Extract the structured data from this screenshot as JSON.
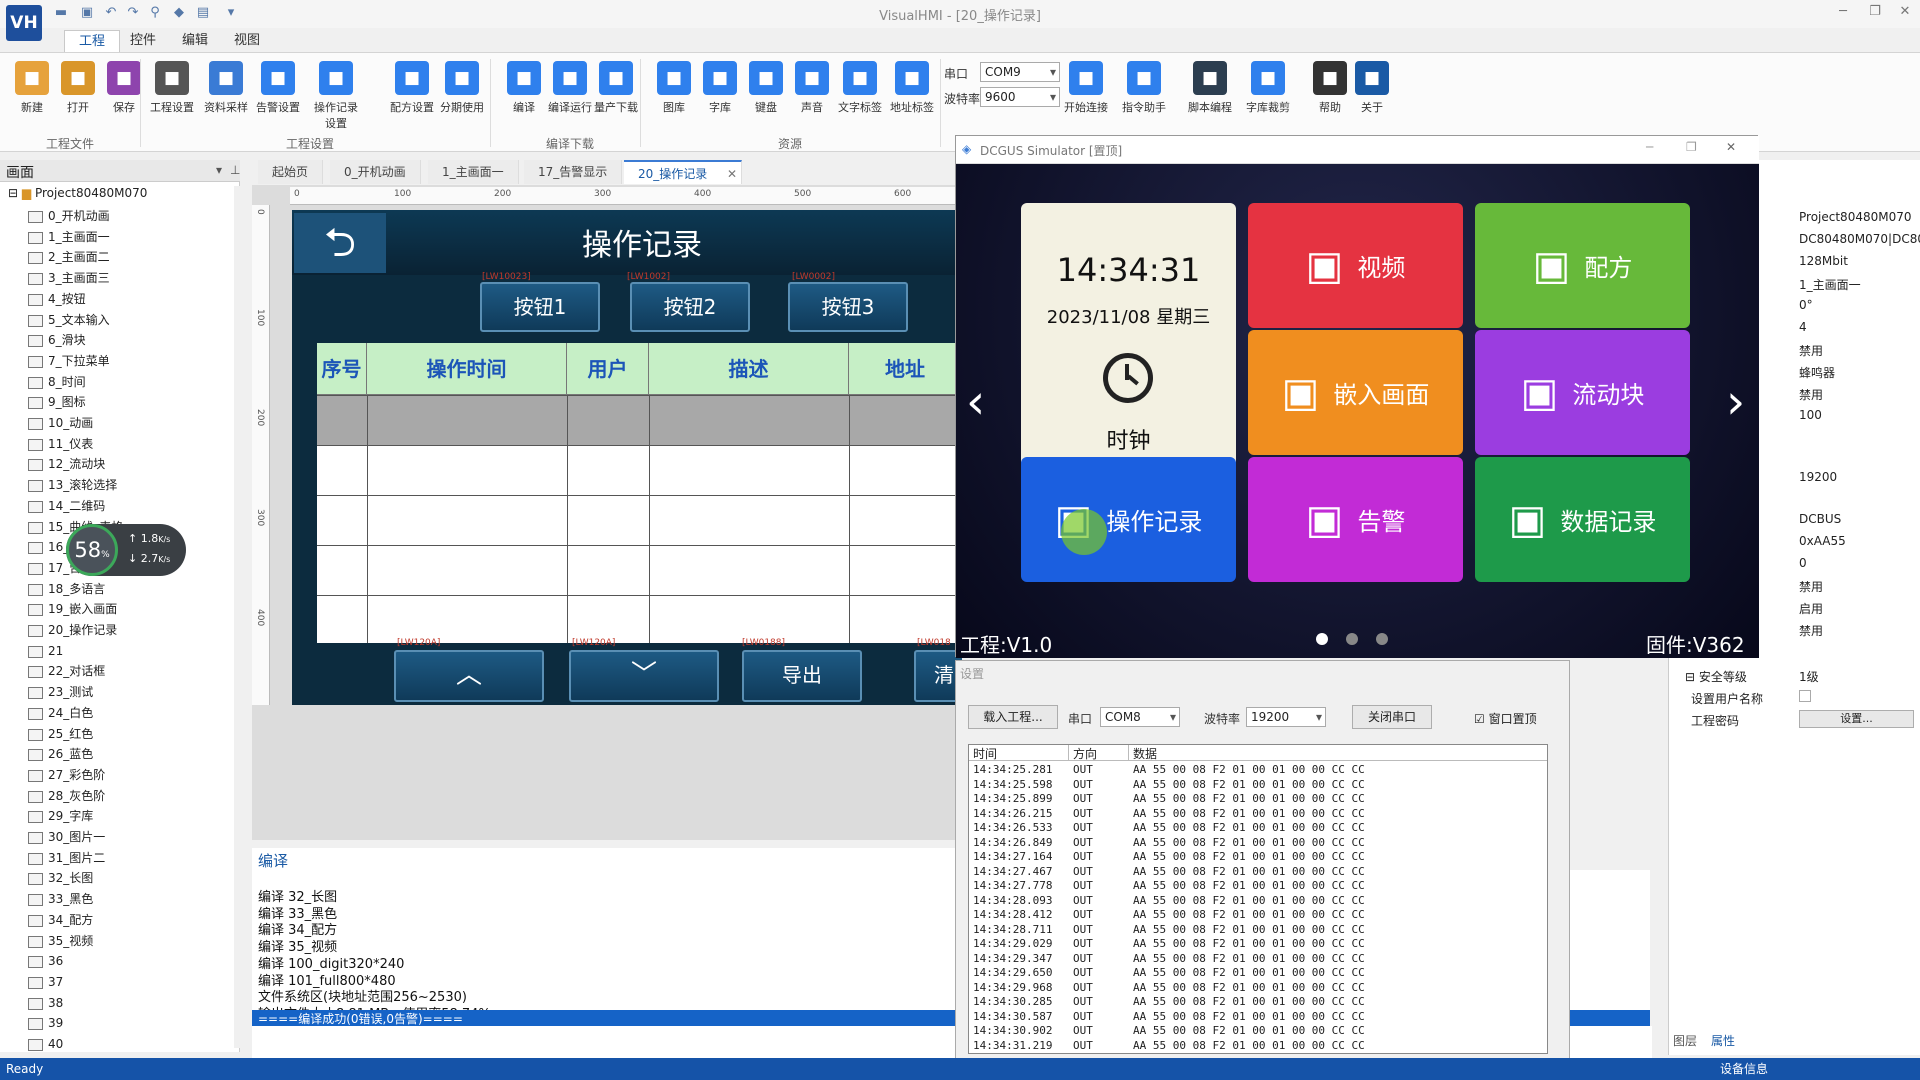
{
  "app": {
    "title": "VisualHMI - [20_操作记录]",
    "logo": "VH",
    "status": "Ready",
    "status_right": "设备信息"
  },
  "menu_tabs": [
    "工程",
    "控件",
    "编辑",
    "视图"
  ],
  "ribbon": {
    "buttons": [
      {
        "label": "新建",
        "icon": "new-file-icon",
        "color": "#e6a23c"
      },
      {
        "label": "打开",
        "icon": "open-folder-icon",
        "color": "#d9962a"
      },
      {
        "label": "保存",
        "icon": "save-icon",
        "color": "#8e44ad"
      },
      {
        "label": "工程设置",
        "icon": "gear-icon",
        "color": "#555"
      },
      {
        "label": "资料采样",
        "icon": "sample-icon",
        "color": "#3a7bd5"
      },
      {
        "label": "告警设置",
        "icon": "alarm-set-icon",
        "color": "#2f80ed"
      },
      {
        "label": "操作记录设置",
        "icon": "op-record-icon",
        "color": "#2f80ed"
      },
      {
        "label": "配方设置",
        "icon": "recipe-icon",
        "color": "#2f80ed"
      },
      {
        "label": "分期使用",
        "icon": "calendar-icon",
        "color": "#2f80ed"
      },
      {
        "label": "编译",
        "icon": "compile-icon",
        "color": "#2f80ed"
      },
      {
        "label": "编译运行",
        "icon": "compile-run-icon",
        "color": "#2f80ed"
      },
      {
        "label": "量产下载",
        "icon": "download-icon",
        "color": "#2f80ed"
      },
      {
        "label": "图库",
        "icon": "image-lib-icon",
        "color": "#2f80ed"
      },
      {
        "label": "字库",
        "icon": "font-lib-icon",
        "color": "#2f80ed"
      },
      {
        "label": "键盘",
        "icon": "keyboard-icon",
        "color": "#2f80ed"
      },
      {
        "label": "声音",
        "icon": "sound-icon",
        "color": "#2f80ed"
      },
      {
        "label": "文字标签",
        "icon": "tag-icon",
        "color": "#2f80ed"
      },
      {
        "label": "地址标签",
        "icon": "addr-tag-icon",
        "color": "#2f80ed"
      },
      {
        "label": "开始连接",
        "icon": "connect-icon",
        "color": "#2f80ed"
      },
      {
        "label": "指令助手",
        "icon": "cmd-helper-icon",
        "color": "#2f80ed"
      },
      {
        "label": "脚本编程",
        "icon": "lua-icon",
        "color": "#2c3e50"
      },
      {
        "label": "字库裁剪",
        "icon": "font-crop-icon",
        "color": "#2f80ed"
      },
      {
        "label": "帮助",
        "icon": "help-icon",
        "color": "#333"
      },
      {
        "label": "关于",
        "icon": "info-icon",
        "color": "#1a5aa5"
      }
    ],
    "groups": [
      "工程文件",
      "工程设置",
      "编译下载",
      "资源"
    ],
    "port_label": "串口",
    "port_value": "COM9",
    "baud_label": "波特率",
    "baud_value": "9600"
  },
  "left_panel": {
    "title": "画面",
    "project": "Project80480M070",
    "items": [
      "0_开机动画",
      "1_主画面一",
      "2_主画面二",
      "3_主画面三",
      "4_按钮",
      "5_文本输入",
      "6_滑块",
      "7_下拉菜单",
      "8_时间",
      "9_图标",
      "10_动画",
      "11_仪表",
      "12_流动块",
      "13_滚轮选择",
      "14_二维码",
      "15_曲线_表格",
      "16_",
      "17_告警显示",
      "18_多语言",
      "19_嵌入画面",
      "20_操作记录",
      "21",
      "22_对话框",
      "23_测试",
      "24_白色",
      "25_红色",
      "26_蓝色",
      "27_彩色阶",
      "28_灰色阶",
      "29_字库",
      "30_图片一",
      "31_图片二",
      "32_长图",
      "33_黑色",
      "34_配方",
      "35_视频",
      "36",
      "37",
      "38",
      "39",
      "40"
    ]
  },
  "perf": {
    "cpu": "58",
    "unit": "%",
    "up": "1.8",
    "down": "2.7",
    "rate_unit": "K/s"
  },
  "doc_tabs": [
    "起始页",
    "0_开机动画",
    "1_主画面一",
    "17_告警显示",
    "20_操作记录"
  ],
  "ruler_h": [
    "0",
    "100",
    "200",
    "300",
    "400",
    "500",
    "600"
  ],
  "ruler_v": [
    "0",
    "100",
    "200",
    "300",
    "400"
  ],
  "hmi": {
    "title": "操作记录",
    "back": "⮌",
    "buttons": [
      "按钮1",
      "按钮2",
      "按钮3"
    ],
    "tags_top": [
      "[LW10023]",
      "[LW1002]",
      "[LW0002]"
    ],
    "tags_bottom": [
      "[LW120A]",
      "[LW120A]",
      "[LW0188]",
      "[LW018"
    ],
    "columns": [
      "序号",
      "操作时间",
      "用户",
      "描述",
      "地址"
    ],
    "nav_buttons": [
      "︿",
      "﹀",
      "导出",
      "清"
    ]
  },
  "compile": {
    "title": "编译",
    "lines": [
      "编译 32_长图",
      "编译 33_黑色",
      "编译 34_配方",
      "编译 35_视频",
      "编译 100_digit320*240",
      "编译 101_full800*480",
      "文件系统区(块地址范围256~2530)",
      "输出文件大小8.81 MB，使用率58.74%."
    ],
    "highlight": "====编译成功(0错误,0告警)===="
  },
  "props": {
    "values": [
      "Project80480M070",
      "DC80480M070|DC80",
      "128Mbit",
      "1_主画面一",
      "0°",
      "4",
      "禁用",
      "蜂鸣器",
      "禁用",
      "100",
      "",
      "19200",
      "DCBUS",
      "0xAA55",
      "0",
      "禁用",
      "启用",
      "禁用"
    ],
    "security_label": "安全等级",
    "security_value": "1级",
    "user_label": "设置用户名称",
    "pwd_label": "工程密码",
    "pwd_btn": "设置...",
    "tab1": "图层",
    "tab2": "属性"
  },
  "simulator": {
    "title": "DCGUS Simulator [置顶]",
    "time": "14:34:31",
    "date": "2023/11/08 星期三",
    "clock_label": "时钟",
    "tiles": [
      {
        "label": "视频",
        "icon": "video-icon",
        "color": "#e53341"
      },
      {
        "label": "配方",
        "icon": "recipe-icon",
        "color": "#67b93a"
      },
      {
        "label": "嵌入画面",
        "icon": "embed-icon",
        "color": "#f08e1f"
      },
      {
        "label": "流动块",
        "icon": "flow-icon",
        "color": "#9b3de0"
      },
      {
        "label": "操作记录",
        "icon": "op-record-icon",
        "color": "#1b5fe0"
      },
      {
        "label": "告警",
        "icon": "warning-icon",
        "color": "#c22bd6"
      },
      {
        "label": "数据记录",
        "icon": "data-record-icon",
        "color": "#1e9a4a"
      }
    ],
    "project_ver": "工程:V1.0",
    "firmware_ver": "固件:V362"
  },
  "settings": {
    "title": "设置",
    "load_btn": "载入工程...",
    "port_label": "串口",
    "port": "COM8",
    "baud_label": "波特率",
    "baud": "19200",
    "close_btn": "关闭串口",
    "topmost": "窗口置顶",
    "headers": [
      "时间",
      "方向",
      "数据"
    ],
    "rows": [
      [
        "14:34:25.281",
        "OUT",
        "AA 55 00 08 F2 01 00 01 00 00 CC CC"
      ],
      [
        "14:34:25.598",
        "OUT",
        "AA 55 00 08 F2 01 00 01 00 00 CC CC"
      ],
      [
        "14:34:25.899",
        "OUT",
        "AA 55 00 08 F2 01 00 01 00 00 CC CC"
      ],
      [
        "14:34:26.215",
        "OUT",
        "AA 55 00 08 F2 01 00 01 00 00 CC CC"
      ],
      [
        "14:34:26.533",
        "OUT",
        "AA 55 00 08 F2 01 00 01 00 00 CC CC"
      ],
      [
        "14:34:26.849",
        "OUT",
        "AA 55 00 08 F2 01 00 01 00 00 CC CC"
      ],
      [
        "14:34:27.164",
        "OUT",
        "AA 55 00 08 F2 01 00 01 00 00 CC CC"
      ],
      [
        "14:34:27.467",
        "OUT",
        "AA 55 00 08 F2 01 00 01 00 00 CC CC"
      ],
      [
        "14:34:27.778",
        "OUT",
        "AA 55 00 08 F2 01 00 01 00 00 CC CC"
      ],
      [
        "14:34:28.093",
        "OUT",
        "AA 55 00 08 F2 01 00 01 00 00 CC CC"
      ],
      [
        "14:34:28.412",
        "OUT",
        "AA 55 00 08 F2 01 00 01 00 00 CC CC"
      ],
      [
        "14:34:28.711",
        "OUT",
        "AA 55 00 08 F2 01 00 01 00 00 CC CC"
      ],
      [
        "14:34:29.029",
        "OUT",
        "AA 55 00 08 F2 01 00 01 00 00 CC CC"
      ],
      [
        "14:34:29.347",
        "OUT",
        "AA 55 00 08 F2 01 00 01 00 00 CC CC"
      ],
      [
        "14:34:29.650",
        "OUT",
        "AA 55 00 08 F2 01 00 01 00 00 CC CC"
      ],
      [
        "14:34:29.968",
        "OUT",
        "AA 55 00 08 F2 01 00 01 00 00 CC CC"
      ],
      [
        "14:34:30.285",
        "OUT",
        "AA 55 00 08 F2 01 00 01 00 00 CC CC"
      ],
      [
        "14:34:30.587",
        "OUT",
        "AA 55 00 08 F2 01 00 01 00 00 CC CC"
      ],
      [
        "14:34:30.902",
        "OUT",
        "AA 55 00 08 F2 01 00 01 00 00 CC CC"
      ],
      [
        "14:34:31.219",
        "OUT",
        "AA 55 00 08 F2 01 00 01 00 00 CC CC"
      ]
    ]
  }
}
